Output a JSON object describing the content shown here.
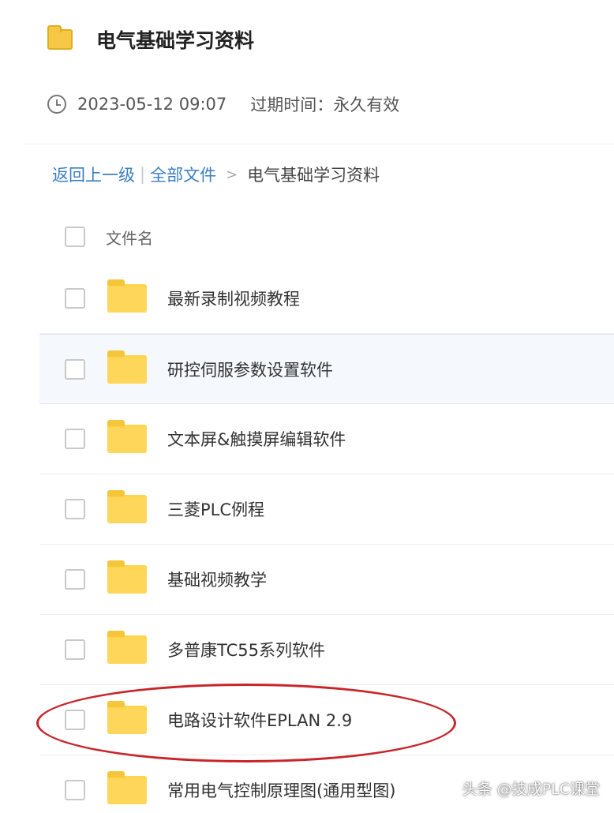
{
  "header": {
    "title": "电气基础学习资料",
    "icon": "folder-icon"
  },
  "meta": {
    "timestamp": "2023-05-12 09:07",
    "expiry": "过期时间：永久有效"
  },
  "breadcrumb": {
    "back": "返回上一级",
    "separator": "|",
    "all_files": "全部文件",
    "arrow": ">",
    "current": "电气基础学习资料"
  },
  "list": {
    "column_name": "文件名",
    "items": [
      {
        "name": "最新录制视频教程"
      },
      {
        "name": "研控伺服参数设置软件"
      },
      {
        "name": "文本屏&触摸屏编辑软件"
      },
      {
        "name": "三菱PLC例程"
      },
      {
        "name": "基础视频教学"
      },
      {
        "name": "多普康TC55系列软件"
      },
      {
        "name": "电路设计软件EPLAN 2.9"
      },
      {
        "name": "常用电气控制原理图(通用型图)"
      }
    ]
  },
  "watermark": "头条 @技成PLC课堂",
  "colors": {
    "link": "#3b7dc4",
    "folder": "#fdd54f",
    "annotation": "#c8252b",
    "hover_row": "#f5f8fc"
  }
}
